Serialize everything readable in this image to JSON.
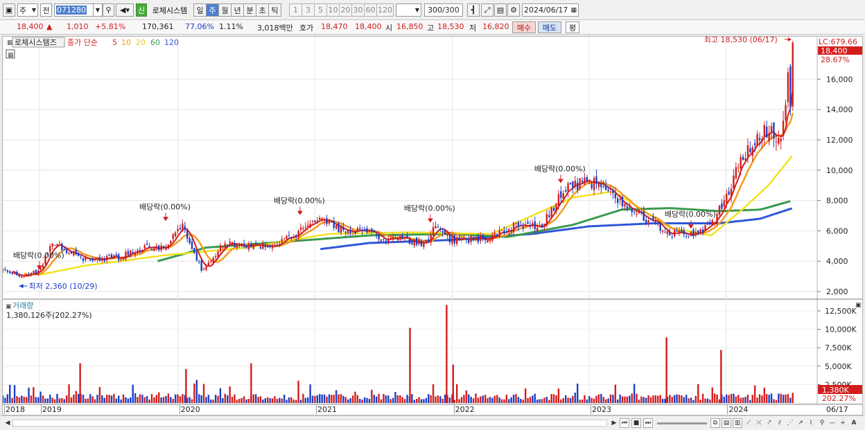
{
  "toolbar": {
    "period_unit": "주",
    "prev_label": "전",
    "stock_code": "071280",
    "badge_new": "신",
    "stock_name": "로체시스템",
    "period_tabs": [
      "일",
      "주",
      "월",
      "년",
      "분",
      "초",
      "틱"
    ],
    "active_period": "주",
    "interval_buttons": [
      "1",
      "3",
      "5",
      "10",
      "20",
      "30",
      "60",
      "120"
    ],
    "count": "300",
    "count_total": "/300",
    "date": "2024/06/17"
  },
  "quote": {
    "price": "18,400",
    "change": "1,010",
    "change_pct": "+5.81%",
    "volume": "170,361",
    "vol_ratio": "77.06%",
    "turnover": "1.11%",
    "trade_value": "3,018백만",
    "ask_label": "호가",
    "ask": "18,470",
    "bid": "18,400",
    "open_label": "시",
    "open": "16,850",
    "high_label": "고",
    "high": "18,530",
    "low_label": "저",
    "low": "16,820",
    "buy_label": "매수",
    "sell_label": "매도",
    "eval_label": "평"
  },
  "price_panel": {
    "stock_label": "로체시스템즈",
    "indicator_label": "종가 단순",
    "ma_periods": [
      "5",
      "10",
      "20",
      "60",
      "120"
    ],
    "lc_label": "LC:679.66",
    "current_tag": "18,400",
    "current_pct": "28.67%",
    "high_annotation": "최고 18,530 (06/17)",
    "low_annotation": "최저 2,360 (10/29)",
    "dividend_label": "배당락(0.00%)",
    "dividend_marks": [
      0.045,
      0.2,
      0.365,
      0.525,
      0.685,
      0.845
    ],
    "y_ticks": [
      "16,000",
      "14,000",
      "12,000",
      "10,000",
      "8,000",
      "6,000",
      "4,000",
      "2,000"
    ]
  },
  "volume_panel": {
    "title": "거래량",
    "value_label": "1,380,126주(202.27%)",
    "y_ticks": [
      "12,500K",
      "10,000K",
      "7,500K",
      "5,000K",
      "2,500K"
    ],
    "current_tag": "1,380K",
    "current_pct": "202.27%"
  },
  "x_axis": {
    "labels": [
      "2018",
      "2019",
      "2020",
      "2021",
      "2022",
      "2023",
      "2024"
    ],
    "end_label": "06/17"
  },
  "colors": {
    "up": "#d21d1d",
    "down": "#1c3fc4",
    "ma5": "#d21d1d",
    "ma10": "#f39c1e",
    "ma20": "#f2e21e",
    "ma60": "#3a9a4e",
    "ma120": "#2f56d8"
  },
  "chart_data": {
    "type": "candlestick+volume",
    "price_range": [
      1500,
      18800
    ],
    "volume_range": [
      0,
      14000
    ],
    "highest": 18530,
    "lowest": 2360,
    "last_close": 18400,
    "ma_legend": [
      "5",
      "10",
      "20",
      "60",
      "120"
    ],
    "anchors_close": [
      [
        0.0,
        3400
      ],
      [
        0.02,
        3000
      ],
      [
        0.045,
        3300
      ],
      [
        0.06,
        5200
      ],
      [
        0.1,
        4100
      ],
      [
        0.14,
        4200
      ],
      [
        0.17,
        4900
      ],
      [
        0.2,
        4900
      ],
      [
        0.22,
        6500
      ],
      [
        0.245,
        3300
      ],
      [
        0.27,
        5100
      ],
      [
        0.3,
        5100
      ],
      [
        0.33,
        5000
      ],
      [
        0.35,
        5500
      ],
      [
        0.39,
        6800
      ],
      [
        0.41,
        6200
      ],
      [
        0.45,
        5800
      ],
      [
        0.48,
        5500
      ],
      [
        0.52,
        5200
      ],
      [
        0.53,
        6500
      ],
      [
        0.55,
        5400
      ],
      [
        0.6,
        5500
      ],
      [
        0.63,
        6400
      ],
      [
        0.66,
        6300
      ],
      [
        0.69,
        8700
      ],
      [
        0.72,
        9300
      ],
      [
        0.75,
        8400
      ],
      [
        0.79,
        6800
      ],
      [
        0.82,
        5800
      ],
      [
        0.845,
        5700
      ],
      [
        0.87,
        6300
      ],
      [
        0.89,
        8500
      ],
      [
        0.91,
        11000
      ],
      [
        0.93,
        12500
      ],
      [
        0.955,
        12300
      ],
      [
        0.97,
        18400
      ]
    ],
    "ma_curves": {
      "ma20": [
        [
          0.045,
          3100
        ],
        [
          0.1,
          3700
        ],
        [
          0.2,
          4400
        ],
        [
          0.3,
          4900
        ],
        [
          0.4,
          5800
        ],
        [
          0.5,
          5900
        ],
        [
          0.6,
          5800
        ],
        [
          0.7,
          8200
        ],
        [
          0.75,
          8600
        ],
        [
          0.82,
          6200
        ],
        [
          0.87,
          5700
        ],
        [
          0.91,
          7500
        ],
        [
          0.94,
          9000
        ],
        [
          0.97,
          11000
        ]
      ],
      "ma60": [
        [
          0.19,
          4000
        ],
        [
          0.25,
          4900
        ],
        [
          0.35,
          5300
        ],
        [
          0.45,
          5700
        ],
        [
          0.55,
          5800
        ],
        [
          0.62,
          5600
        ],
        [
          0.7,
          6400
        ],
        [
          0.76,
          7400
        ],
        [
          0.82,
          7500
        ],
        [
          0.88,
          7300
        ],
        [
          0.93,
          7400
        ],
        [
          0.97,
          8000
        ]
      ],
      "ma120": [
        [
          0.39,
          4800
        ],
        [
          0.45,
          5200
        ],
        [
          0.55,
          5400
        ],
        [
          0.65,
          5800
        ],
        [
          0.72,
          6300
        ],
        [
          0.8,
          6500
        ],
        [
          0.88,
          6500
        ],
        [
          0.93,
          6800
        ],
        [
          0.97,
          7500
        ]
      ]
    },
    "volume_spikes": [
      [
        0.5,
        10200
      ],
      [
        0.545,
        13300
      ],
      [
        0.553,
        5200
      ],
      [
        0.815,
        8900
      ],
      [
        0.882,
        7200
      ],
      [
        0.225,
        4600
      ],
      [
        0.305,
        5400
      ],
      [
        0.095,
        5400
      ]
    ]
  }
}
